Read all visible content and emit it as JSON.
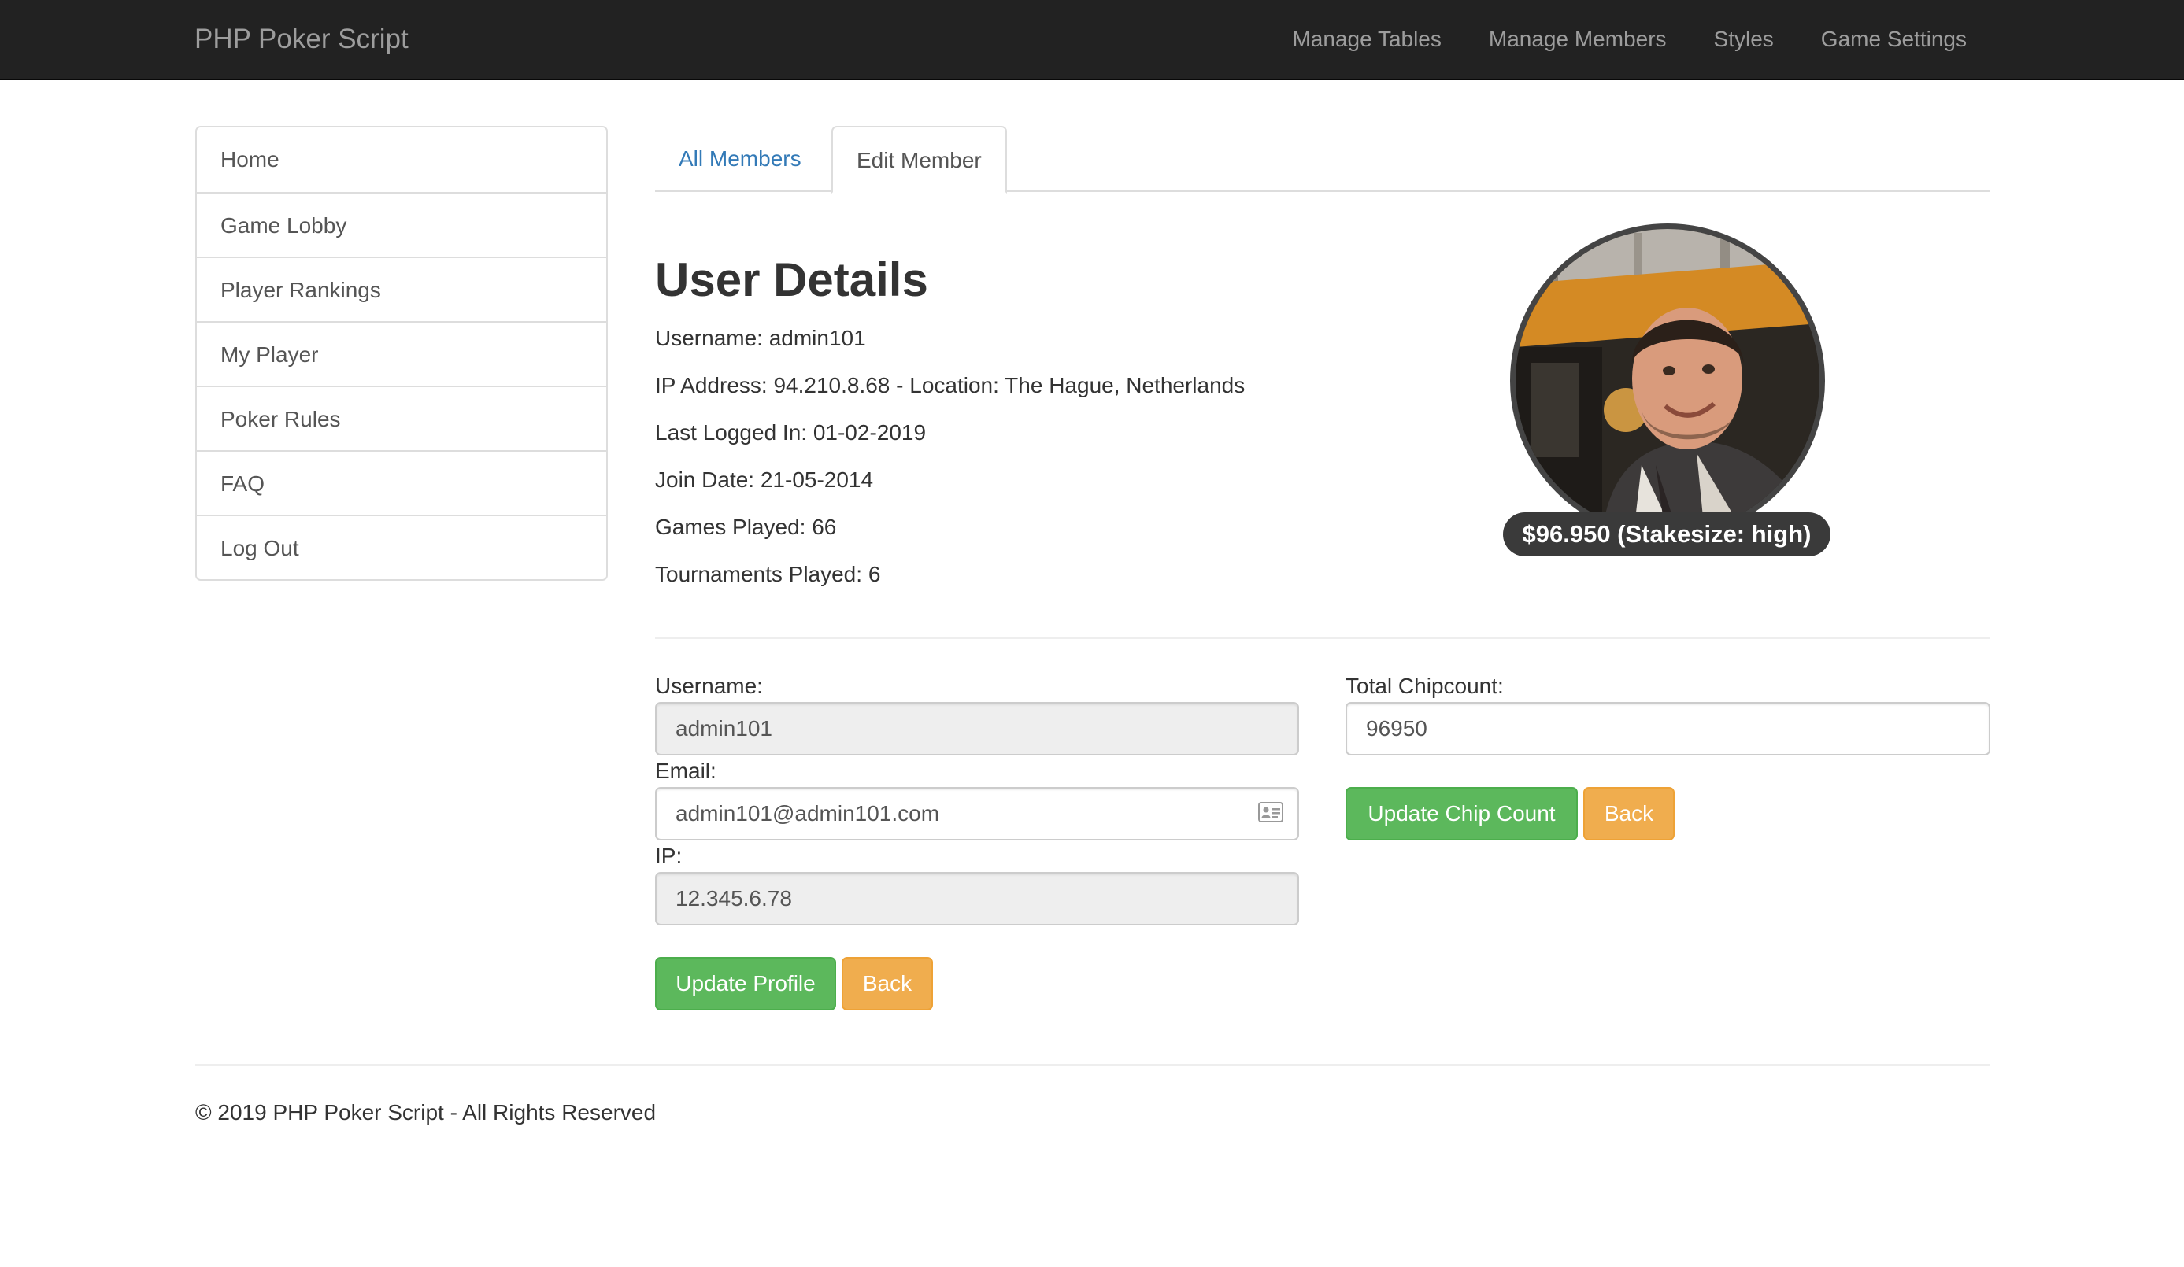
{
  "navbar": {
    "brand": "PHP Poker Script",
    "links": [
      "Manage Tables",
      "Manage Members",
      "Styles",
      "Game Settings"
    ]
  },
  "sidebar": {
    "items": [
      "Home",
      "Game Lobby",
      "Player Rankings",
      "My Player",
      "Poker Rules",
      "FAQ",
      "Log Out"
    ]
  },
  "tabs": {
    "all_members": "All Members",
    "edit_member": "Edit Member"
  },
  "details": {
    "title": "User Details",
    "username": "Username: admin101",
    "ip_location": "IP Address: 94.210.8.68 - Location: The Hague, Netherlands",
    "last_logged": "Last Logged In: 01-02-2019",
    "join_date": "Join Date: 21-05-2014",
    "games_played": "Games Played: 66",
    "tournaments_played": "Tournaments Played: 6",
    "chip_badge": "$96.950 (Stakesize: high)"
  },
  "form": {
    "username_label": "Username:",
    "username_value": "admin101",
    "email_label": "Email:",
    "email_value": "admin101@admin101.com",
    "ip_label": "IP:",
    "ip_value": "12.345.6.78",
    "update_profile": "Update Profile",
    "back": "Back",
    "chipcount_label": "Total Chipcount:",
    "chipcount_value": "96950",
    "update_chip_count": "Update Chip Count",
    "back_chip": "Back"
  },
  "icons": {
    "email_field": "contact-card-icon",
    "avatar": "user-avatar-photo"
  },
  "colors": {
    "navbar_bg": "#222222",
    "link": "#337ab7",
    "success": "#5cb85c",
    "warning": "#f0ad4e"
  },
  "footer": {
    "text": "© 2019 PHP Poker Script - All Rights Reserved"
  }
}
